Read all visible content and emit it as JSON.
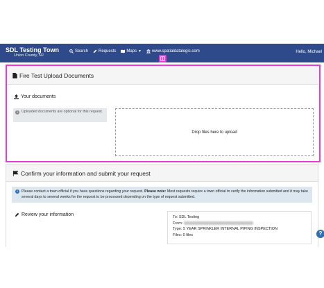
{
  "navbar": {
    "brand_title": "SDL Testing Town",
    "brand_subtitle": "Union County, NJ",
    "search_label": "Search",
    "requests_label": "Requests",
    "maps_label": "Maps",
    "site_label": "www.spatialdatalogic.com",
    "greeting": "Hello, Michael"
  },
  "upload_panel": {
    "title": "Fire Test Upload Documents",
    "your_documents_label": "Your documents",
    "note": "Uploaded documents are optional for this request.",
    "dropzone_text": "Drop files here to upload"
  },
  "confirm_panel": {
    "title": "Confirm your information and submit your request",
    "alert_text": "Please contact a town official if you have questions regarding your request.",
    "alert_bold": "Please note:",
    "alert_rest": "Most requests require a town official to verify the information submitted and it may take several days to several weeks for the request to be processed depending on the type of request submitted.",
    "review_label": "Review your information",
    "summary": {
      "to_label": "To:",
      "to_value": "SDL Testing",
      "from_label": "From:",
      "type_label": "Type:",
      "type_value": "5 YEAR SPRINKLER INTERNAL PIPING INSPECTION",
      "files_label": "Files:",
      "files_value": "0 files"
    }
  },
  "help_label": "?",
  "colors": {
    "navbar": "#2e4a8a",
    "highlight": "#e83bd2",
    "info_blue": "#2e6fb7"
  }
}
